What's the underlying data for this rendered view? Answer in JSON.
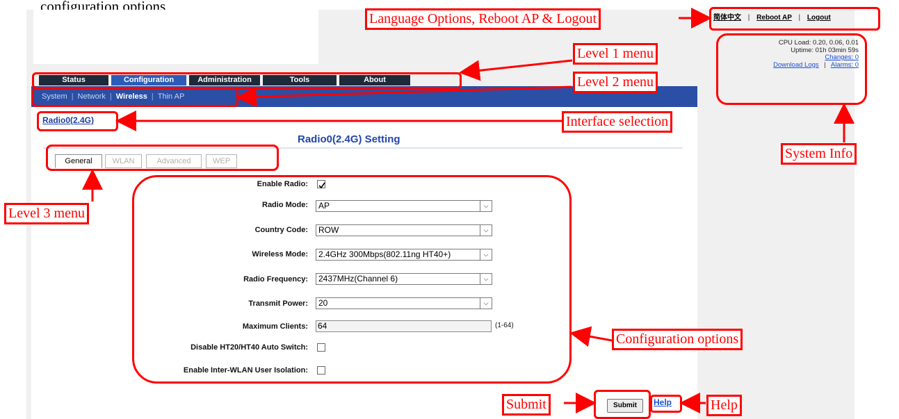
{
  "top_cut_text": "configuration options",
  "top_links": {
    "language": "简体中文",
    "reboot": "Reboot AP",
    "logout": "Logout",
    "separator": "|"
  },
  "system_info": {
    "cpu_load": "CPU Load: 0.20, 0.06, 0.01",
    "uptime": "Uptime: 01h 03min 59s",
    "changes": "Changes: 0",
    "download_logs": "Download Logs",
    "alarms": "Alarms: 0",
    "separator": "|"
  },
  "level1_menu": [
    "Status",
    "Configuration",
    "Administration",
    "Tools",
    "About"
  ],
  "level1_active": "Configuration",
  "level2_menu": [
    "System",
    "Network",
    "Wireless",
    "Thin AP"
  ],
  "level2_active": "Wireless",
  "level2_separator": "|",
  "interface_link": "Radio0(2.4G)",
  "section_title": "Radio0(2.4G) Setting",
  "level3_tabs": [
    "General",
    "WLAN",
    "Advanced",
    "WEP"
  ],
  "level3_active": "General",
  "form": {
    "enable_radio": {
      "label": "Enable Radio:",
      "checked": true
    },
    "radio_mode": {
      "label": "Radio Mode:",
      "value": "AP"
    },
    "country_code": {
      "label": "Country Code:",
      "value": "ROW"
    },
    "wireless_mode": {
      "label": "Wireless Mode:",
      "value": "2.4GHz 300Mbps(802.11ng HT40+)"
    },
    "radio_frequency": {
      "label": "Radio Frequency:",
      "value": "2437MHz(Channel 6)"
    },
    "transmit_power": {
      "label": "Transmit Power:",
      "value": "20"
    },
    "max_clients": {
      "label": "Maximum Clients:",
      "value": "64",
      "hint": "(1-64)"
    },
    "disable_ht_switch": {
      "label": "Disable HT20/HT40 Auto Switch:",
      "checked": false
    },
    "inter_wlan_isolation": {
      "label": "Enable Inter-WLAN User Isolation:",
      "checked": false
    }
  },
  "buttons": {
    "submit": "Submit",
    "help": "Help"
  },
  "annotations": {
    "top_links": "Language Options, Reboot AP & Logout",
    "level1": "Level 1 menu",
    "level2": "Level 2 menu",
    "interface": "Interface selection",
    "system_info": "System Info",
    "level3": "Level 3 menu",
    "config": "Configuration options",
    "submit": "Submit",
    "help": "Help"
  },
  "colors": {
    "annotation": "#ff0000",
    "menu_dark": "#1d2a3a",
    "menu_blue": "#2a5cb8",
    "submenu_bar": "#2a4fa5",
    "title_blue": "#2146a8"
  }
}
